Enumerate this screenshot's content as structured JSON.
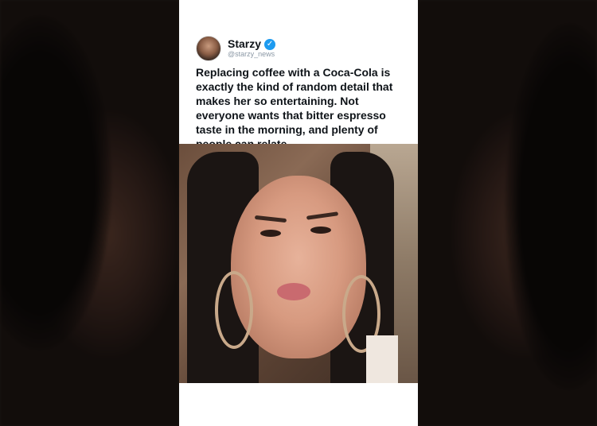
{
  "post": {
    "display_name": "Starzy",
    "handle": "@starzy_news",
    "verified_icon": "verified-badge-icon",
    "text": "Replacing coffee with a Coca-Cola is exactly the kind of random detail that makes her so entertaining. Not everyone wants that bitter espresso taste in the morning, and plenty of people can relate.",
    "verified_color": "#1d9bf0"
  },
  "media": {
    "type": "photo"
  },
  "colors": {
    "card_background": "#ffffff",
    "text": "#0f1419",
    "handle": "#8b98a5"
  }
}
